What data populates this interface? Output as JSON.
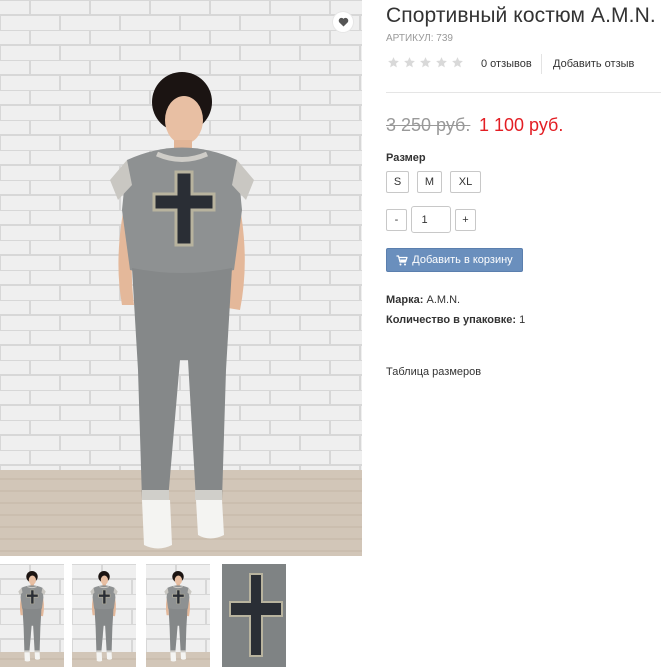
{
  "product": {
    "title": "Спортивный костюм A.M.N.",
    "sku": "АРТИКУЛ: 739",
    "rating_stars": 0,
    "reviews_count": "0 отзывов",
    "write_review": "Добавить отзыв",
    "old_price": "3 250 руб.",
    "new_price": "1 100 руб."
  },
  "size": {
    "label": "Размер",
    "options": [
      "S",
      "M",
      "XL"
    ]
  },
  "quantity": {
    "minus": "-",
    "value": "1",
    "plus": "+"
  },
  "cart": {
    "label": "Добавить в корзину",
    "icon": "cart-icon"
  },
  "attributes": {
    "brand_label": "Марка:",
    "brand_value": "A.M.N.",
    "pack_label": "Количество в упаковке:",
    "pack_value": "1"
  },
  "size_table_link": "Таблица размеров",
  "icons": {
    "wishlist": "heart-icon",
    "rating": "star-icon"
  },
  "colors": {
    "price_new": "#e31e24",
    "price_old": "#999999",
    "button": "#6a8fbd",
    "star_empty": "#d9d9d9"
  }
}
